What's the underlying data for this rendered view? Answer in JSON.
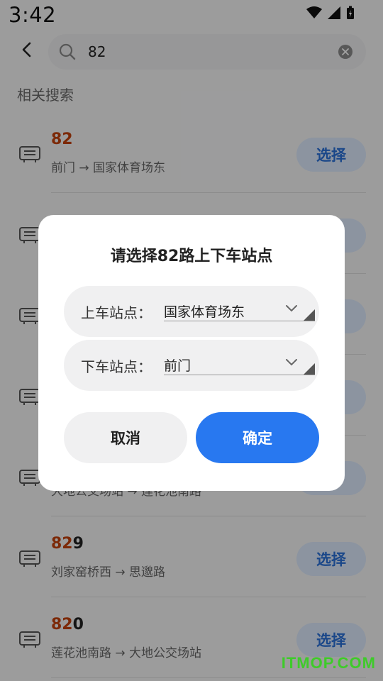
{
  "status_bar": {
    "time": "3:42"
  },
  "search": {
    "back_icon": "back-arrow-icon",
    "search_icon": "search-icon",
    "query": "82",
    "clear_icon": "clear-icon"
  },
  "section_title": "相关搜索",
  "results": [
    {
      "route_match": "82",
      "route_rest": "",
      "direction": "前门 → 国家体育场东",
      "button": "选择"
    },
    {
      "route_match": "",
      "route_rest": "",
      "direction": "",
      "button": ""
    },
    {
      "route_match": "",
      "route_rest": "",
      "direction": "",
      "button": ""
    },
    {
      "route_match": "",
      "route_rest": "",
      "direction": "",
      "button": ""
    },
    {
      "route_match": "",
      "route_rest": "",
      "direction": "大地公交场站 → 莲花池南路",
      "button": ""
    },
    {
      "route_match": "82",
      "route_rest": "9",
      "direction": "刘家窑桥西 → 思邈路",
      "button": "选择"
    },
    {
      "route_match": "82",
      "route_rest": "0",
      "direction": "莲花池南路 → 大地公交场站",
      "button": "选择"
    }
  ],
  "dialog": {
    "title": "请选择82路上下车站点",
    "board_label": "上车站点：",
    "board_value": "国家体育场东",
    "alight_label": "下车站点：",
    "alight_value": "前门",
    "cancel": "取消",
    "confirm": "确定"
  },
  "watermark": "ITMOP.COM",
  "colors": {
    "accent": "#2878f0",
    "route_highlight": "#c2410c",
    "select_button_bg": "#dbe8fb"
  }
}
